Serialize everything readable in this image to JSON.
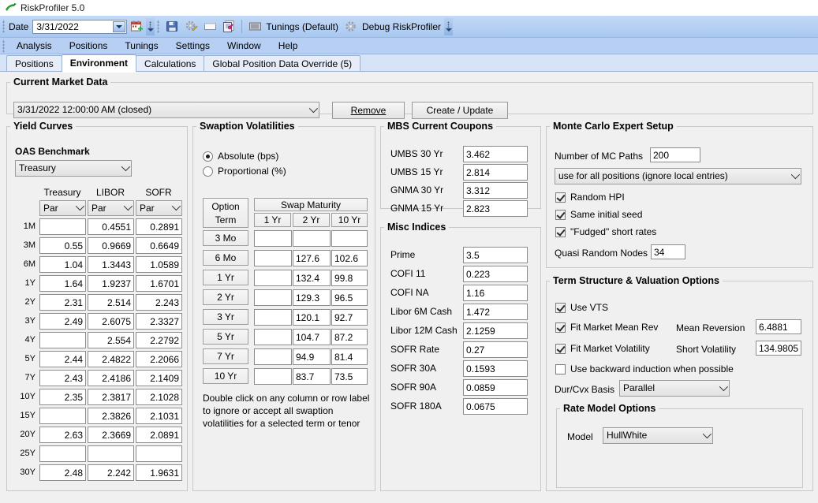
{
  "window": {
    "title": "RiskProfiler 5.0"
  },
  "toolbar": {
    "date_label": "Date",
    "date_value": "3/31/2022",
    "tunings_label": "Tunings (Default)",
    "debug_label": "Debug RiskProfiler",
    "icons": [
      "calendar-add-icon",
      "save-icon",
      "settings-pencil-icon",
      "window-icon",
      "report-icon",
      "tunings-grid-icon",
      "gear-icon"
    ]
  },
  "menubar": {
    "items": [
      "Analysis",
      "Positions",
      "Tunings",
      "Settings",
      "Window",
      "Help"
    ]
  },
  "tabs": [
    {
      "label": "Positions",
      "active": false
    },
    {
      "label": "Environment",
      "active": true
    },
    {
      "label": "Calculations",
      "active": false
    },
    {
      "label": "Global Position Data Override (5)",
      "active": false
    }
  ],
  "market_data": {
    "legend": "Current Market Data",
    "selected": "3/31/2022 12:00:00 AM (closed)",
    "remove_label": "Remove",
    "create_update_label": "Create / Update"
  },
  "yield_curves": {
    "legend": "Yield Curves",
    "oas_label": "OAS Benchmark",
    "oas_value": "Treasury",
    "columns": [
      "Treasury",
      "LIBOR",
      "SOFR"
    ],
    "col_types": [
      "Par",
      "Par",
      "Par"
    ],
    "rows": [
      {
        "tenor": "1M",
        "treasury": "",
        "libor": "0.4551",
        "sofr": "0.2891"
      },
      {
        "tenor": "3M",
        "treasury": "0.55",
        "libor": "0.9669",
        "sofr": "0.6649"
      },
      {
        "tenor": "6M",
        "treasury": "1.04",
        "libor": "1.3443",
        "sofr": "1.0589"
      },
      {
        "tenor": "1Y",
        "treasury": "1.64",
        "libor": "1.9237",
        "sofr": "1.6701"
      },
      {
        "tenor": "2Y",
        "treasury": "2.31",
        "libor": "2.514",
        "sofr": "2.243"
      },
      {
        "tenor": "3Y",
        "treasury": "2.49",
        "libor": "2.6075",
        "sofr": "2.3327"
      },
      {
        "tenor": "4Y",
        "treasury": "",
        "libor": "2.554",
        "sofr": "2.2792"
      },
      {
        "tenor": "5Y",
        "treasury": "2.44",
        "libor": "2.4822",
        "sofr": "2.2066"
      },
      {
        "tenor": "7Y",
        "treasury": "2.43",
        "libor": "2.4186",
        "sofr": "2.1409"
      },
      {
        "tenor": "10Y",
        "treasury": "2.35",
        "libor": "2.3817",
        "sofr": "2.1028"
      },
      {
        "tenor": "15Y",
        "treasury": "",
        "libor": "2.3826",
        "sofr": "2.1031"
      },
      {
        "tenor": "20Y",
        "treasury": "2.63",
        "libor": "2.3669",
        "sofr": "2.0891"
      },
      {
        "tenor": "25Y",
        "treasury": "",
        "libor": "",
        "sofr": ""
      },
      {
        "tenor": "30Y",
        "treasury": "2.48",
        "libor": "2.242",
        "sofr": "1.9631"
      }
    ]
  },
  "swaption": {
    "legend": "Swaption Volatilities",
    "mode_absolute": "Absolute (bps)",
    "mode_proportional": "Proportional (%)",
    "mode_selected": "absolute",
    "option_term_label": "Option Term",
    "swap_maturity_label": "Swap Maturity",
    "maturities": [
      "1 Yr",
      "2 Yr",
      "10 Yr"
    ],
    "rows": [
      {
        "term": "3 Mo",
        "values": [
          "",
          "",
          ""
        ]
      },
      {
        "term": "6 Mo",
        "values": [
          "",
          "127.6",
          "102.6"
        ]
      },
      {
        "term": "1 Yr",
        "values": [
          "",
          "132.4",
          "99.8"
        ]
      },
      {
        "term": "2 Yr",
        "values": [
          "",
          "129.3",
          "96.5"
        ]
      },
      {
        "term": "3 Yr",
        "values": [
          "",
          "120.1",
          "92.7"
        ]
      },
      {
        "term": "5 Yr",
        "values": [
          "",
          "104.7",
          "87.2"
        ]
      },
      {
        "term": "7 Yr",
        "values": [
          "",
          "94.9",
          "81.4"
        ]
      },
      {
        "term": "10 Yr",
        "values": [
          "",
          "83.7",
          "73.5"
        ]
      }
    ],
    "hint": "Double click on any column or row label to ignore or accept all swaption volatilities for a selected term or tenor"
  },
  "mbs": {
    "legend": "MBS Current Coupons",
    "rows": [
      {
        "label": "UMBS 30 Yr",
        "value": "3.462"
      },
      {
        "label": "UMBS 15 Yr",
        "value": "2.814"
      },
      {
        "label": "GNMA 30 Yr",
        "value": "3.312"
      },
      {
        "label": "GNMA 15 Yr",
        "value": "2.823"
      }
    ]
  },
  "misc_indices": {
    "legend": "Misc Indices",
    "rows": [
      {
        "label": "Prime",
        "value": "3.5"
      },
      {
        "label": "COFI 11",
        "value": "0.223"
      },
      {
        "label": "COFI NA",
        "value": "1.16"
      },
      {
        "label": "Libor 6M Cash",
        "value": "1.472"
      },
      {
        "label": "Libor 12M Cash",
        "value": "2.1259"
      },
      {
        "label": "SOFR Rate",
        "value": "0.27"
      },
      {
        "label": "SOFR 30A",
        "value": "0.1593"
      },
      {
        "label": "SOFR 90A",
        "value": "0.0859"
      },
      {
        "label": "SOFR 180A",
        "value": "0.0675"
      }
    ]
  },
  "monte_carlo": {
    "legend": "Monte Carlo Expert Setup",
    "paths_label": "Number of MC Paths",
    "paths_value": "200",
    "scope_value": "use for all positions (ignore local entries)",
    "checks": [
      {
        "label": "Random HPI",
        "checked": true
      },
      {
        "label": "Same initial seed",
        "checked": true
      },
      {
        "label": "\"Fudged\" short rates",
        "checked": true
      }
    ],
    "quasi_label": "Quasi Random Nodes",
    "quasi_value": "34"
  },
  "term_structure": {
    "legend": "Term Structure & Valuation Options",
    "use_vts_label": "Use VTS",
    "use_vts_checked": true,
    "fit_mean_rev_label": "Fit Market Mean Rev",
    "fit_mean_rev_checked": true,
    "mean_reversion_label": "Mean Reversion",
    "mean_reversion_value": "6.4881",
    "fit_volatility_label": "Fit Market Volatility",
    "fit_volatility_checked": true,
    "short_volatility_label": "Short Volatility",
    "short_volatility_value": "134.9805",
    "backward_induction_label": "Use backward induction when possible",
    "backward_induction_checked": false,
    "durcvx_label": "Dur/Cvx Basis",
    "durcvx_value": "Parallel"
  },
  "rate_model": {
    "legend": "Rate Model Options",
    "model_label": "Model",
    "model_value": "HullWhite"
  },
  "colors": {
    "toolbar_top": "#c3d9f7",
    "toolbar_bottom": "#a9c8f0",
    "menubar": "#b6cff3",
    "page_bg": "#f0f0f0",
    "tab_active": "#ffffff"
  }
}
